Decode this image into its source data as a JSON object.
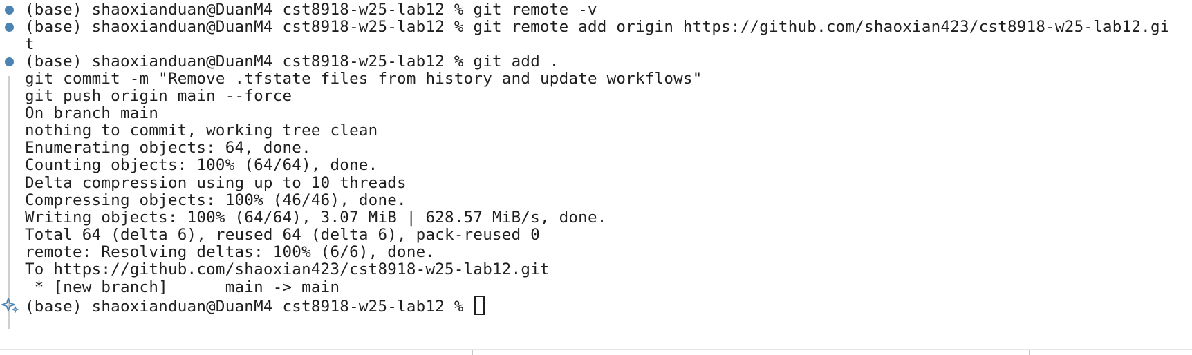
{
  "terminal": {
    "lines": [
      {
        "gutter": "dot",
        "text": "(base) shaoxianduan@DuanM4 cst8918-w25-lab12 % git remote -v"
      },
      {
        "gutter": "dot",
        "text": "(base) shaoxianduan@DuanM4 cst8918-w25-lab12 % git remote add origin https://github.com/shaoxian423/cst8918-w25-lab12.gi"
      },
      {
        "gutter": "",
        "text": "t"
      },
      {
        "gutter": "dot",
        "text": "(base) shaoxianduan@DuanM4 cst8918-w25-lab12 % git add ."
      },
      {
        "gutter": "",
        "text": "git commit -m \"Remove .tfstate files from history and update workflows\""
      },
      {
        "gutter": "",
        "text": "git push origin main --force"
      },
      {
        "gutter": "",
        "text": "On branch main"
      },
      {
        "gutter": "",
        "text": "nothing to commit, working tree clean"
      },
      {
        "gutter": "",
        "text": "Enumerating objects: 64, done."
      },
      {
        "gutter": "",
        "text": "Counting objects: 100% (64/64), done."
      },
      {
        "gutter": "",
        "text": "Delta compression using up to 10 threads"
      },
      {
        "gutter": "",
        "text": "Compressing objects: 100% (46/46), done."
      },
      {
        "gutter": "",
        "text": "Writing objects: 100% (64/64), 3.07 MiB | 628.57 MiB/s, done."
      },
      {
        "gutter": "",
        "text": "Total 64 (delta 6), reused 64 (delta 6), pack-reused 0"
      },
      {
        "gutter": "",
        "text": "remote: Resolving deltas: 100% (6/6), done."
      },
      {
        "gutter": "",
        "text": "To https://github.com/shaoxian423/cst8918-w25-lab12.git"
      },
      {
        "gutter": "",
        "text": " * [new branch]      main -> main"
      },
      {
        "gutter": "sparkle",
        "text": "(base) shaoxianduan@DuanM4 cst8918-w25-lab12 % "
      }
    ]
  },
  "icons": {
    "command_decoration": "circle-dot-icon",
    "prompt_decoration": "sparkle-icon"
  },
  "colors": {
    "decoration_dot": "#4b83b3",
    "sparkle": "#4b83b3",
    "text": "#1f1f1f",
    "background": "#ffffff"
  }
}
